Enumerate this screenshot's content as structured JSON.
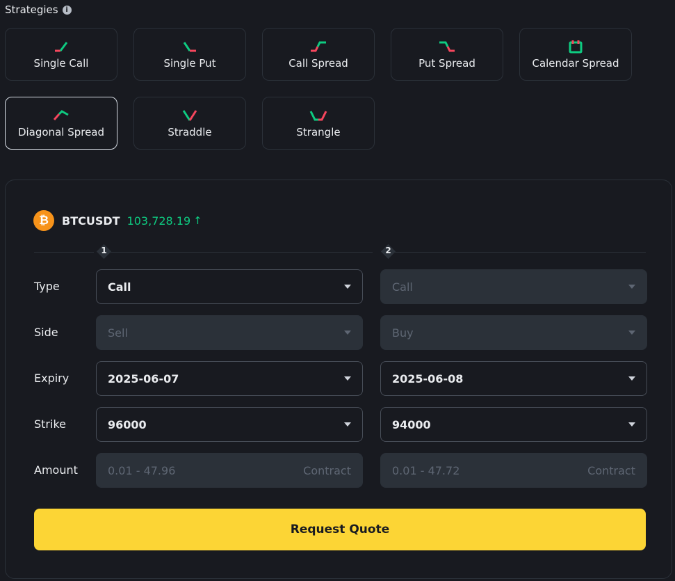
{
  "header": {
    "title": "Strategies",
    "info_icon": "i"
  },
  "colors": {
    "green": "#0ecb81",
    "red": "#f6465d",
    "yellow": "#fcd535",
    "bg": "#181a20",
    "border": "#2b3139"
  },
  "strategies": [
    {
      "label": "Single Call",
      "icon": "single-call-icon"
    },
    {
      "label": "Single Put",
      "icon": "single-put-icon"
    },
    {
      "label": "Call Spread",
      "icon": "call-spread-icon"
    },
    {
      "label": "Put Spread",
      "icon": "put-spread-icon"
    },
    {
      "label": "Calendar Spread",
      "icon": "calendar-spread-icon"
    },
    {
      "label": "Diagonal Spread",
      "icon": "diagonal-spread-icon",
      "selected": true
    },
    {
      "label": "Straddle",
      "icon": "straddle-icon"
    },
    {
      "label": "Strangle",
      "icon": "strangle-icon"
    }
  ],
  "market": {
    "coin_symbol": "₿",
    "pair": "BTCUSDT",
    "price": "103,728.19",
    "direction": "↑"
  },
  "legs": {
    "leg1": "1",
    "leg2": "2"
  },
  "rows": {
    "type": {
      "label": "Type",
      "leg1": "Call",
      "leg2": "Call"
    },
    "side": {
      "label": "Side",
      "leg1": "Sell",
      "leg2": "Buy"
    },
    "expiry": {
      "label": "Expiry",
      "leg1": "2025-06-07",
      "leg2": "2025-06-08"
    },
    "strike": {
      "label": "Strike",
      "leg1": "96000",
      "leg2": "94000"
    },
    "amount": {
      "label": "Amount",
      "leg1_placeholder": "0.01 - 47.96",
      "leg2_placeholder": "0.01 - 47.72",
      "unit": "Contract"
    }
  },
  "request_button": "Request Quote"
}
